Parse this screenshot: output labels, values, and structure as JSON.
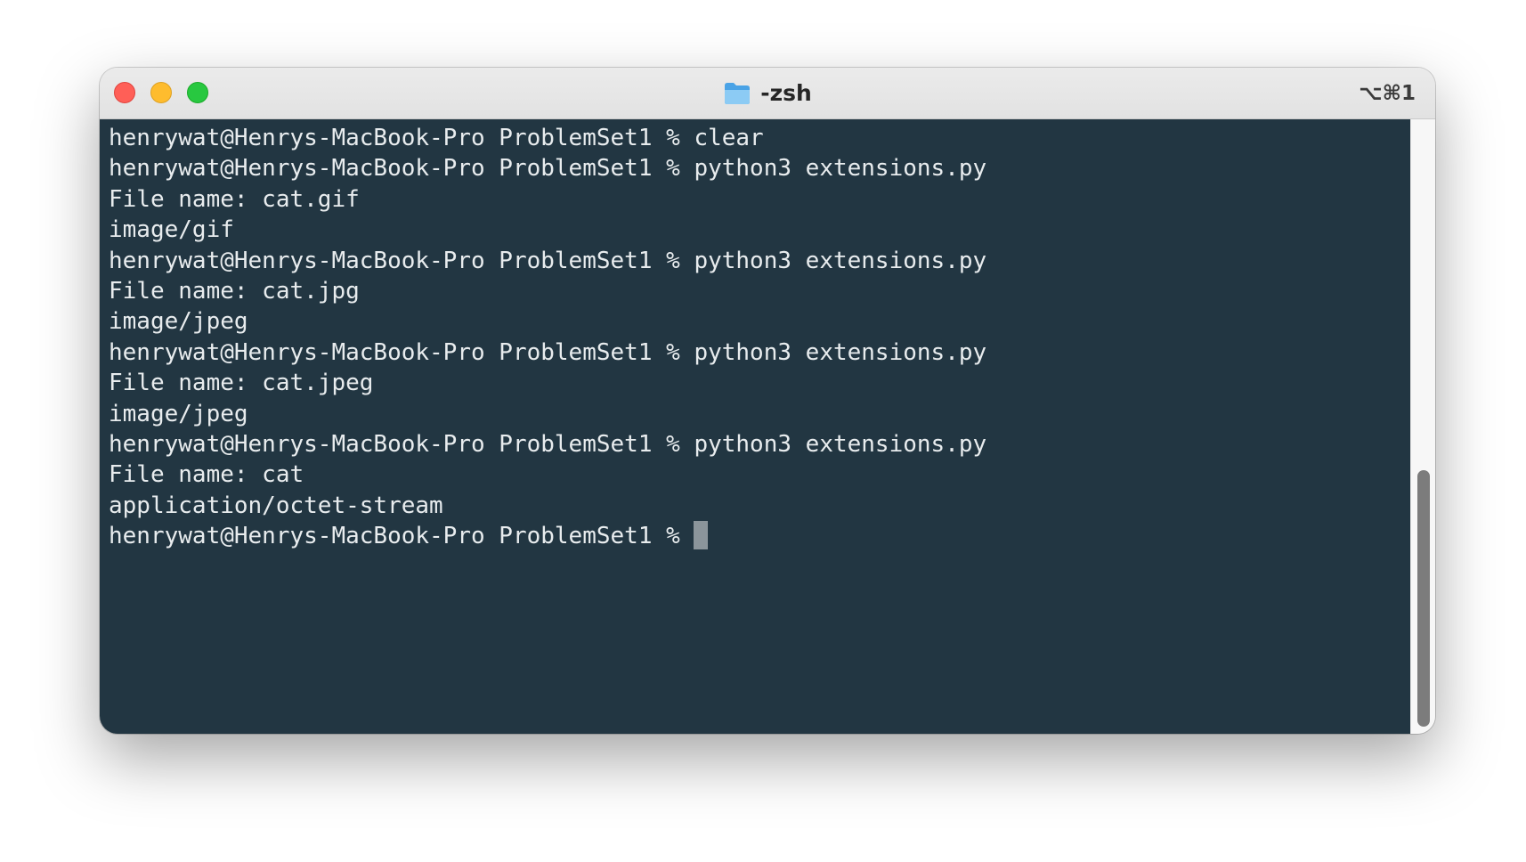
{
  "window": {
    "title": "-zsh",
    "shortcut": "⌥⌘1",
    "title_icon": "folder-icon"
  },
  "terminal": {
    "lines": [
      "henrywat@Henrys-MacBook-Pro ProblemSet1 % clear",
      "henrywat@Henrys-MacBook-Pro ProblemSet1 % python3 extensions.py",
      "File name: cat.gif",
      "image/gif",
      "henrywat@Henrys-MacBook-Pro ProblemSet1 % python3 extensions.py",
      "File name: cat.jpg",
      "image/jpeg",
      "henrywat@Henrys-MacBook-Pro ProblemSet1 % python3 extensions.py",
      "File name: cat.jpeg",
      "image/jpeg",
      "henrywat@Henrys-MacBook-Pro ProblemSet1 % python3 extensions.py",
      "File name: cat",
      "application/octet-stream"
    ],
    "prompt": "henrywat@Henrys-MacBook-Pro ProblemSet1 % "
  },
  "colors": {
    "terminal_bg": "#223642",
    "terminal_fg": "#e8ecee",
    "close": "#ff5f57",
    "minimize": "#febc2e",
    "zoom": "#28c840"
  }
}
